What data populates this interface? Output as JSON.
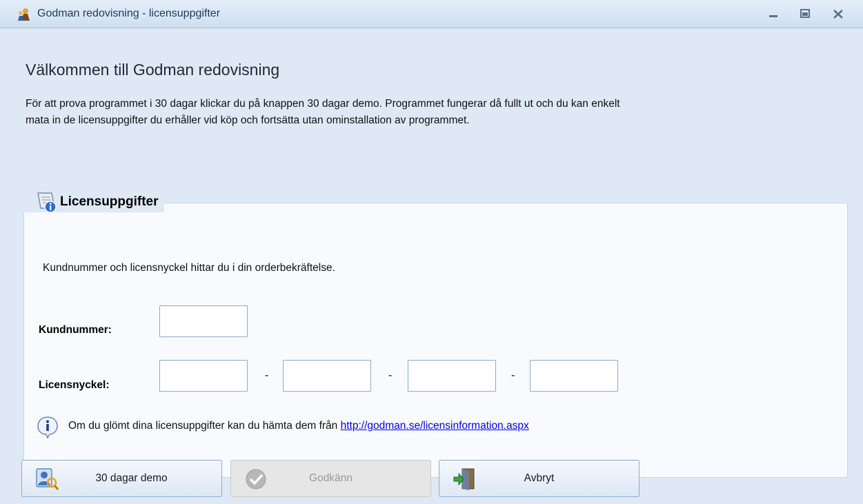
{
  "window": {
    "title": "Godman redovisning - licensuppgifter",
    "controls": [
      "minimize-icon",
      "maximize-icon",
      "close-icon"
    ]
  },
  "main": {
    "heading": "Välkommen till Godman redovisning",
    "intro_line1": "För att prova programmet i 30 dagar klickar du på knappen 30 dagar demo. Programmet fungerar då fullt ut och du kan enkelt",
    "intro_line2": "mata in de licensuppgifter du erhåller vid köp och fortsätta utan ominstallation av programmet."
  },
  "license_group": {
    "title": "Licensuppgifter",
    "hint": "Kundnummer och licensnyckel hittar du i din orderbekräftelse.",
    "customer_label": "Kundnummer:",
    "customer_value": "",
    "key_label": "Licensnyckel:",
    "key_parts": [
      "",
      "",
      "",
      ""
    ],
    "separator": "-",
    "info_text": "Om du glömt dina licensuppgifter kan du hämta dem från ",
    "info_link": "http://godman.se/licensinformation.aspx"
  },
  "buttons": {
    "demo": "30 dagar demo",
    "approve": "Godkänn",
    "cancel": "Avbryt"
  },
  "colors": {
    "window_bg": "#dfe9f5",
    "title_text": "#1e395b",
    "link": "#0000ee",
    "border": "#8ea9cb"
  }
}
